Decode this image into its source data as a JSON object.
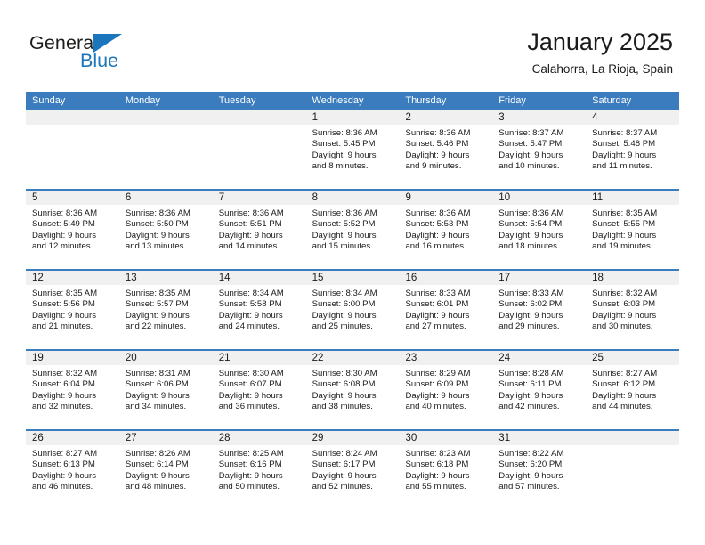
{
  "brand": {
    "name_part1": "General",
    "name_part2": "Blue",
    "accent_color": "#1b76bc"
  },
  "header": {
    "title": "January 2025",
    "subtitle": "Calahorra, La Rioja, Spain"
  },
  "theme": {
    "header_row_bg": "#3a7cbe",
    "cell_head_bg": "#f0f0f0",
    "text_color": "#1a1a1a"
  },
  "calendar": {
    "weekday_headers": [
      "Sunday",
      "Monday",
      "Tuesday",
      "Wednesday",
      "Thursday",
      "Friday",
      "Saturday"
    ],
    "weeks": [
      [
        {
          "empty": true
        },
        {
          "empty": true
        },
        {
          "empty": true
        },
        {
          "day": "1",
          "sunrise": "Sunrise: 8:36 AM",
          "sunset": "Sunset: 5:45 PM",
          "daylight1": "Daylight: 9 hours",
          "daylight2": "and 8 minutes."
        },
        {
          "day": "2",
          "sunrise": "Sunrise: 8:36 AM",
          "sunset": "Sunset: 5:46 PM",
          "daylight1": "Daylight: 9 hours",
          "daylight2": "and 9 minutes."
        },
        {
          "day": "3",
          "sunrise": "Sunrise: 8:37 AM",
          "sunset": "Sunset: 5:47 PM",
          "daylight1": "Daylight: 9 hours",
          "daylight2": "and 10 minutes."
        },
        {
          "day": "4",
          "sunrise": "Sunrise: 8:37 AM",
          "sunset": "Sunset: 5:48 PM",
          "daylight1": "Daylight: 9 hours",
          "daylight2": "and 11 minutes."
        }
      ],
      [
        {
          "day": "5",
          "sunrise": "Sunrise: 8:36 AM",
          "sunset": "Sunset: 5:49 PM",
          "daylight1": "Daylight: 9 hours",
          "daylight2": "and 12 minutes."
        },
        {
          "day": "6",
          "sunrise": "Sunrise: 8:36 AM",
          "sunset": "Sunset: 5:50 PM",
          "daylight1": "Daylight: 9 hours",
          "daylight2": "and 13 minutes."
        },
        {
          "day": "7",
          "sunrise": "Sunrise: 8:36 AM",
          "sunset": "Sunset: 5:51 PM",
          "daylight1": "Daylight: 9 hours",
          "daylight2": "and 14 minutes."
        },
        {
          "day": "8",
          "sunrise": "Sunrise: 8:36 AM",
          "sunset": "Sunset: 5:52 PM",
          "daylight1": "Daylight: 9 hours",
          "daylight2": "and 15 minutes."
        },
        {
          "day": "9",
          "sunrise": "Sunrise: 8:36 AM",
          "sunset": "Sunset: 5:53 PM",
          "daylight1": "Daylight: 9 hours",
          "daylight2": "and 16 minutes."
        },
        {
          "day": "10",
          "sunrise": "Sunrise: 8:36 AM",
          "sunset": "Sunset: 5:54 PM",
          "daylight1": "Daylight: 9 hours",
          "daylight2": "and 18 minutes."
        },
        {
          "day": "11",
          "sunrise": "Sunrise: 8:35 AM",
          "sunset": "Sunset: 5:55 PM",
          "daylight1": "Daylight: 9 hours",
          "daylight2": "and 19 minutes."
        }
      ],
      [
        {
          "day": "12",
          "sunrise": "Sunrise: 8:35 AM",
          "sunset": "Sunset: 5:56 PM",
          "daylight1": "Daylight: 9 hours",
          "daylight2": "and 21 minutes."
        },
        {
          "day": "13",
          "sunrise": "Sunrise: 8:35 AM",
          "sunset": "Sunset: 5:57 PM",
          "daylight1": "Daylight: 9 hours",
          "daylight2": "and 22 minutes."
        },
        {
          "day": "14",
          "sunrise": "Sunrise: 8:34 AM",
          "sunset": "Sunset: 5:58 PM",
          "daylight1": "Daylight: 9 hours",
          "daylight2": "and 24 minutes."
        },
        {
          "day": "15",
          "sunrise": "Sunrise: 8:34 AM",
          "sunset": "Sunset: 6:00 PM",
          "daylight1": "Daylight: 9 hours",
          "daylight2": "and 25 minutes."
        },
        {
          "day": "16",
          "sunrise": "Sunrise: 8:33 AM",
          "sunset": "Sunset: 6:01 PM",
          "daylight1": "Daylight: 9 hours",
          "daylight2": "and 27 minutes."
        },
        {
          "day": "17",
          "sunrise": "Sunrise: 8:33 AM",
          "sunset": "Sunset: 6:02 PM",
          "daylight1": "Daylight: 9 hours",
          "daylight2": "and 29 minutes."
        },
        {
          "day": "18",
          "sunrise": "Sunrise: 8:32 AM",
          "sunset": "Sunset: 6:03 PM",
          "daylight1": "Daylight: 9 hours",
          "daylight2": "and 30 minutes."
        }
      ],
      [
        {
          "day": "19",
          "sunrise": "Sunrise: 8:32 AM",
          "sunset": "Sunset: 6:04 PM",
          "daylight1": "Daylight: 9 hours",
          "daylight2": "and 32 minutes."
        },
        {
          "day": "20",
          "sunrise": "Sunrise: 8:31 AM",
          "sunset": "Sunset: 6:06 PM",
          "daylight1": "Daylight: 9 hours",
          "daylight2": "and 34 minutes."
        },
        {
          "day": "21",
          "sunrise": "Sunrise: 8:30 AM",
          "sunset": "Sunset: 6:07 PM",
          "daylight1": "Daylight: 9 hours",
          "daylight2": "and 36 minutes."
        },
        {
          "day": "22",
          "sunrise": "Sunrise: 8:30 AM",
          "sunset": "Sunset: 6:08 PM",
          "daylight1": "Daylight: 9 hours",
          "daylight2": "and 38 minutes."
        },
        {
          "day": "23",
          "sunrise": "Sunrise: 8:29 AM",
          "sunset": "Sunset: 6:09 PM",
          "daylight1": "Daylight: 9 hours",
          "daylight2": "and 40 minutes."
        },
        {
          "day": "24",
          "sunrise": "Sunrise: 8:28 AM",
          "sunset": "Sunset: 6:11 PM",
          "daylight1": "Daylight: 9 hours",
          "daylight2": "and 42 minutes."
        },
        {
          "day": "25",
          "sunrise": "Sunrise: 8:27 AM",
          "sunset": "Sunset: 6:12 PM",
          "daylight1": "Daylight: 9 hours",
          "daylight2": "and 44 minutes."
        }
      ],
      [
        {
          "day": "26",
          "sunrise": "Sunrise: 8:27 AM",
          "sunset": "Sunset: 6:13 PM",
          "daylight1": "Daylight: 9 hours",
          "daylight2": "and 46 minutes."
        },
        {
          "day": "27",
          "sunrise": "Sunrise: 8:26 AM",
          "sunset": "Sunset: 6:14 PM",
          "daylight1": "Daylight: 9 hours",
          "daylight2": "and 48 minutes."
        },
        {
          "day": "28",
          "sunrise": "Sunrise: 8:25 AM",
          "sunset": "Sunset: 6:16 PM",
          "daylight1": "Daylight: 9 hours",
          "daylight2": "and 50 minutes."
        },
        {
          "day": "29",
          "sunrise": "Sunrise: 8:24 AM",
          "sunset": "Sunset: 6:17 PM",
          "daylight1": "Daylight: 9 hours",
          "daylight2": "and 52 minutes."
        },
        {
          "day": "30",
          "sunrise": "Sunrise: 8:23 AM",
          "sunset": "Sunset: 6:18 PM",
          "daylight1": "Daylight: 9 hours",
          "daylight2": "and 55 minutes."
        },
        {
          "day": "31",
          "sunrise": "Sunrise: 8:22 AM",
          "sunset": "Sunset: 6:20 PM",
          "daylight1": "Daylight: 9 hours",
          "daylight2": "and 57 minutes."
        },
        {
          "empty": true
        }
      ]
    ]
  }
}
